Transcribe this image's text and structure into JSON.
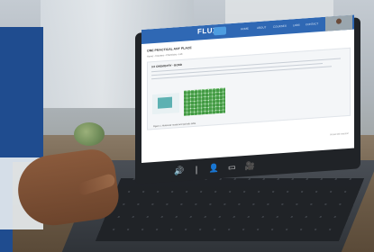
{
  "site": {
    "logo": "FLUX",
    "nav": [
      "HOME",
      "ABOUT",
      "COURSES",
      "LABS",
      "CONTACT"
    ]
  },
  "page": {
    "title": "ONE PRACTICAL ANY PLACE",
    "breadcrumbs": "Home  ›  Courses  ›  Chemistry  ›  Lab",
    "panel_title": "3.0 CHEMISTRY - BOND",
    "caption": "Figure 1. Molecular model and periodic table",
    "footer": "Virtual lab session"
  },
  "icons": {
    "volume": "🔊",
    "pointer": "❘",
    "participants": "👤",
    "screen": "▭",
    "camera": "🎥"
  },
  "colors": {
    "topbar": "#2f68b4",
    "accent": "#1f4c8f"
  }
}
